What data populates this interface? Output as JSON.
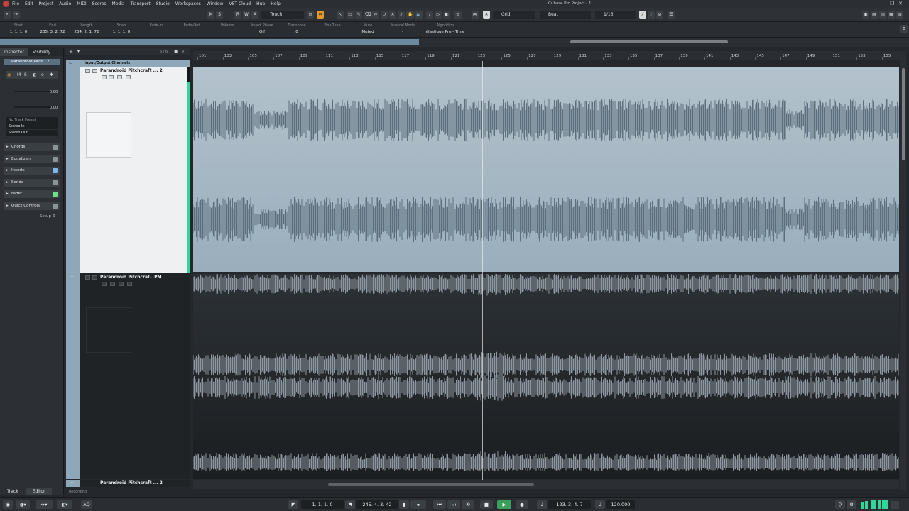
{
  "menu": {
    "items": [
      "File",
      "Edit",
      "Project",
      "Audio",
      "MIDI",
      "Scores",
      "Media",
      "Transport",
      "Studio",
      "Workspaces",
      "Window",
      "VST Cloud",
      "Hub",
      "Help"
    ],
    "window_title": "Cubase Pro Project - 1"
  },
  "toolbar": {
    "mute": "M",
    "solo": "S",
    "read": "R",
    "write": "W",
    "auto": "A",
    "automation_mode": "Touch",
    "snap_type": "Grid",
    "grid_type": "Beat",
    "quantize": "1/16"
  },
  "infoline": [
    {
      "label": "Start",
      "value": "1. 1. 1.    0"
    },
    {
      "label": "End",
      "value": "235. 3. 2. 72"
    },
    {
      "label": "Length",
      "value": "234. 2. 1. 72"
    },
    {
      "label": "Snap",
      "value": "1. 1. 1.    0"
    },
    {
      "label": "Fade-In",
      "value": ""
    },
    {
      "label": "Fade-Out",
      "value": ""
    },
    {
      "label": "Volume",
      "value": ""
    },
    {
      "label": "Invert Phase",
      "value": "Off"
    },
    {
      "label": "Transpose",
      "value": "0"
    },
    {
      "label": "Fine-Tune",
      "value": ""
    },
    {
      "label": "Mute",
      "value": "Muted"
    },
    {
      "label": "Musical Mode",
      "value": "-"
    },
    {
      "label": "Algorithm",
      "value": "élastique Pro - Time"
    }
  ],
  "inspector": {
    "tabs": [
      "Inspector",
      "Visibility"
    ],
    "track_name": "Parandroid Pitch...2",
    "volume_value": "0.00",
    "pan_value": "0.00",
    "routing": [
      "No Track Preset",
      "Stereo In",
      "Stereo Out"
    ],
    "sections": [
      "Chords",
      "Equalizers",
      "Inserts",
      "Sends",
      "Fader",
      "Quick Controls"
    ],
    "setup_label": "Setup"
  },
  "tracklist": {
    "count": "6 / 6",
    "folder_name": "Input/Output Channels",
    "track1_name": "Parandroid Pitchcraft ... 2",
    "track2_name": "Parandroid Pitchcraf...PM",
    "track3_name": "Parandroid Pitchcraft ... 2",
    "status": "Recording"
  },
  "ruler": {
    "bars": [
      "101",
      "103",
      "105",
      "107",
      "109",
      "111",
      "113",
      "115",
      "117",
      "119",
      "121",
      "123",
      "125",
      "127",
      "129",
      "131",
      "133",
      "135",
      "137",
      "139",
      "141",
      "143",
      "145",
      "147",
      "149",
      "151",
      "153",
      "155"
    ]
  },
  "bottom_tabs": [
    "Track",
    "Editor"
  ],
  "transport": {
    "left_locator": "1. 1. 1.    0",
    "right_locator": "245. 4. 3. 42",
    "position": "123. 3. 4.   7",
    "tempo": "120.000"
  },
  "colors": {
    "track_blue": "#8fa8b9",
    "meter_green": "#31d69a",
    "play_green": "#3aa05a",
    "tool_orange": "#e39a2b"
  }
}
